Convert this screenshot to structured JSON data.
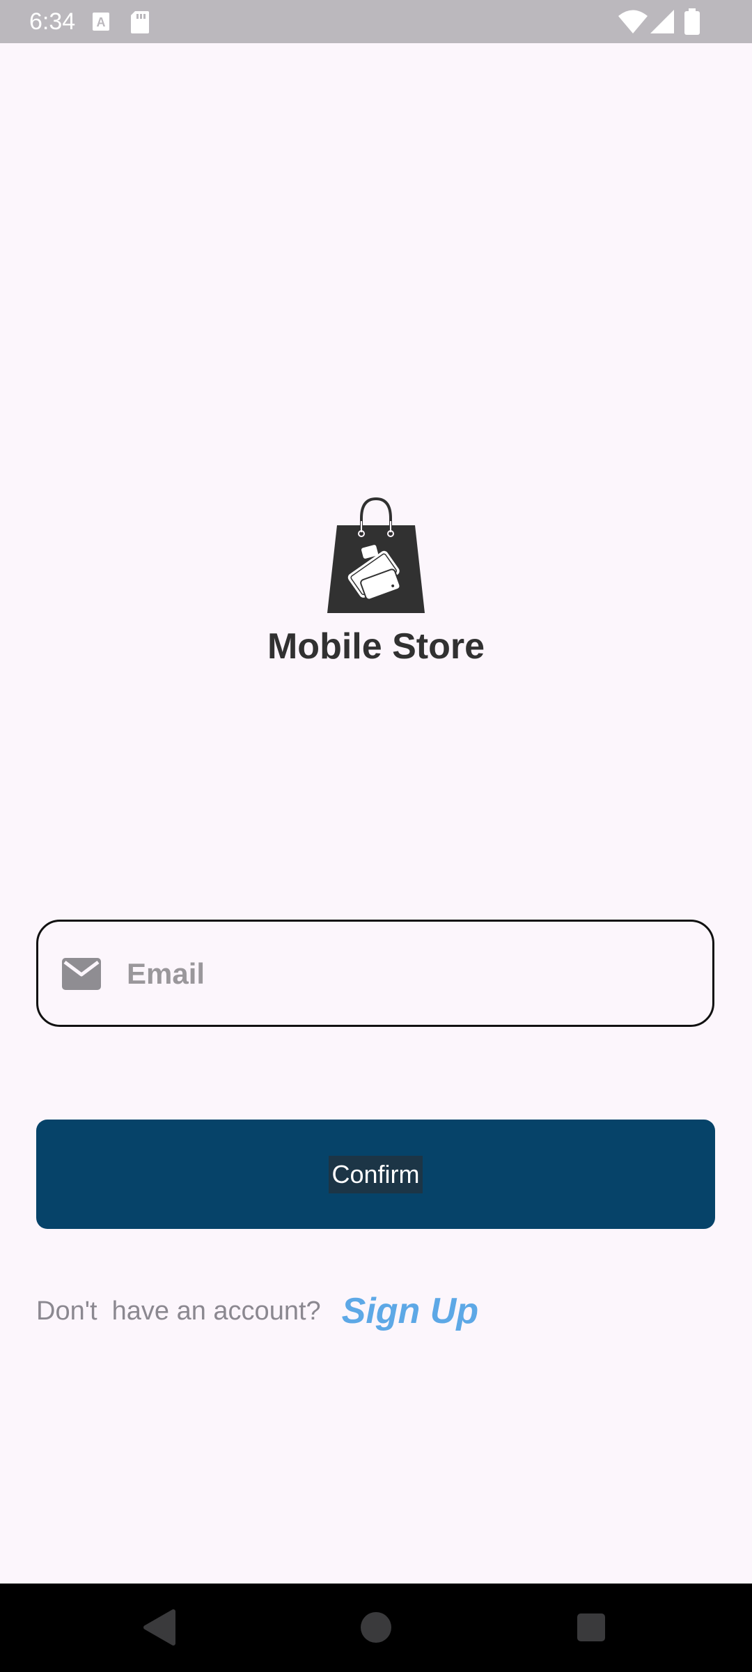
{
  "status_bar": {
    "time": "6:34",
    "icons": [
      "a-notification-icon",
      "sd-card-icon",
      "wifi-icon",
      "cell-signal-icon",
      "battery-icon"
    ]
  },
  "branding": {
    "logo_icon": "shopping-bag-phones-icon",
    "app_title": "Mobile Store"
  },
  "login_form": {
    "email": {
      "icon": "mail-icon",
      "placeholder": "Email",
      "value": ""
    },
    "confirm_label": "Confirm"
  },
  "signup": {
    "prompt": "Don't  have an account?",
    "link_label": "Sign Up"
  },
  "nav_bar": {
    "buttons": [
      "back-icon",
      "home-icon",
      "recents-icon"
    ]
  },
  "colors": {
    "background": "#fcf6fc",
    "status_bar": "#bbb8bd",
    "primary_button": "#064369",
    "link": "#5da8e6",
    "title_text": "#313131",
    "placeholder_text": "#9a979b"
  }
}
